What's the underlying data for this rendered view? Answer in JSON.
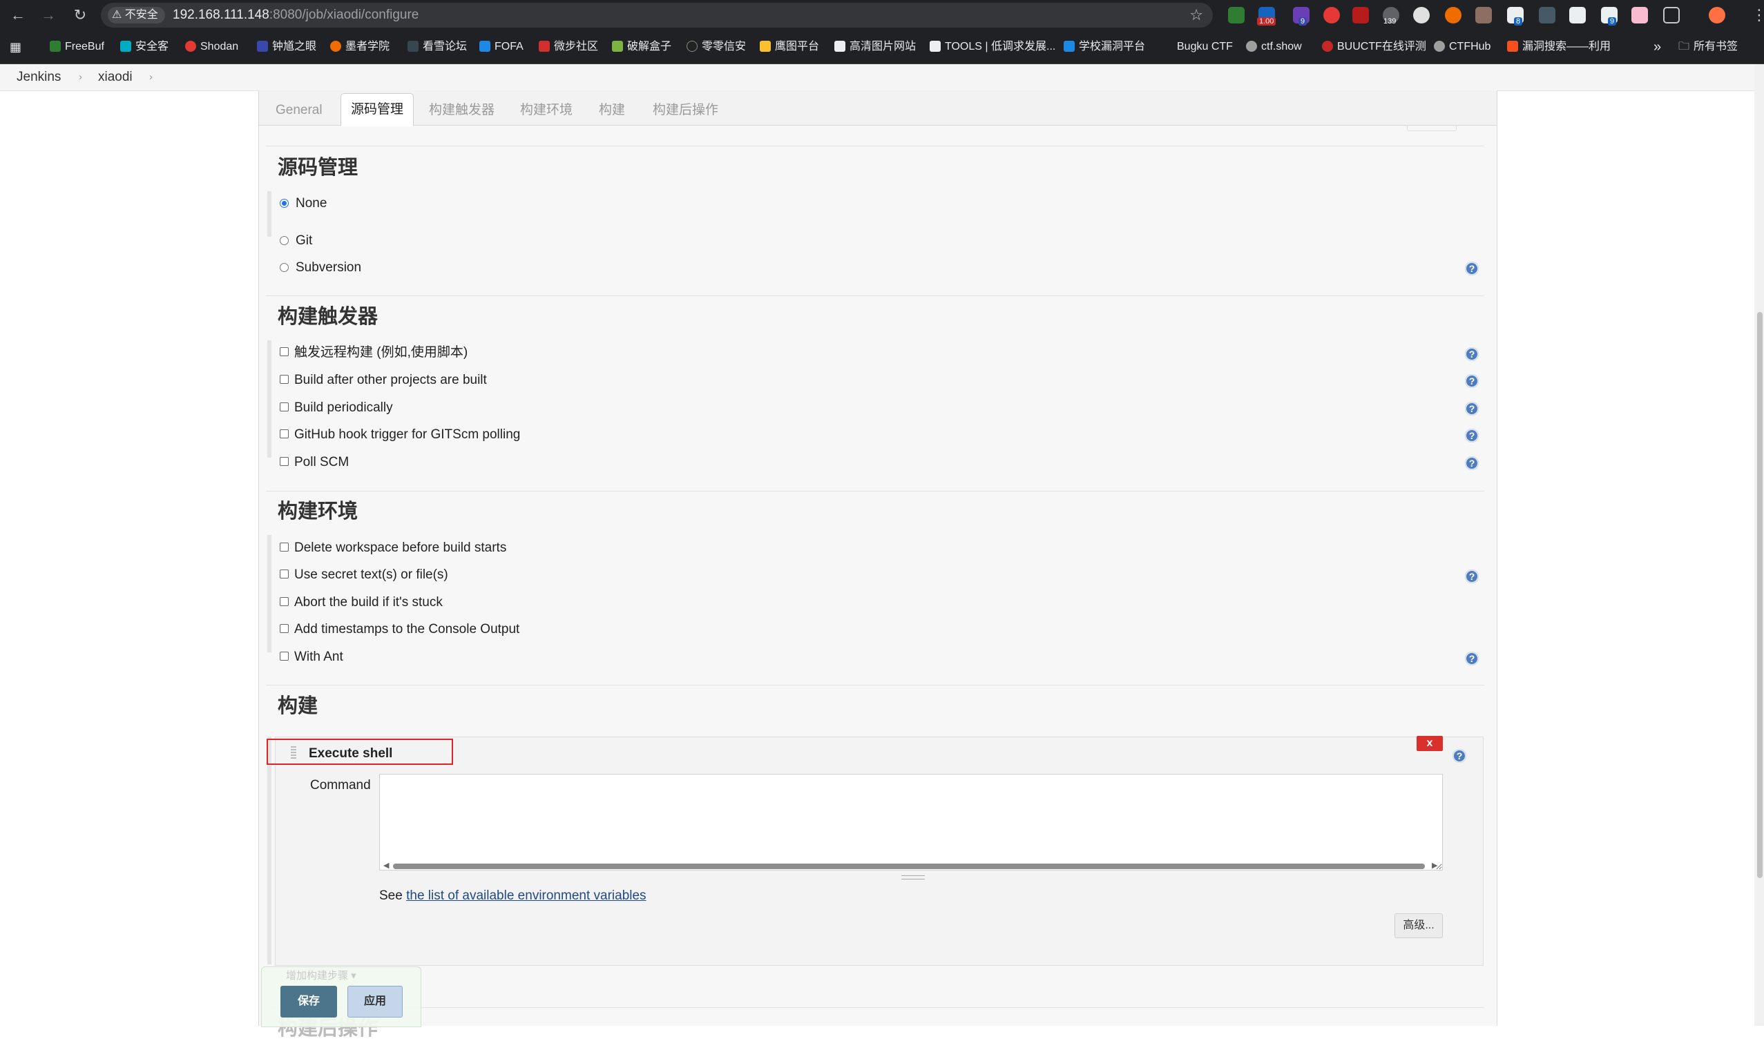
{
  "browser": {
    "security_label": "不安全",
    "url_host": "192.168.111.148",
    "url_rest": ":8080/job/xiaodi/configure",
    "extension_badges": [
      "1.00",
      "9",
      "139",
      "8",
      "9"
    ],
    "bookmarks": [
      "FreeBuf",
      "安全客",
      "Shodan",
      "钟馗之眼",
      "墨者学院",
      "看雪论坛",
      "FOFA",
      "微步社区",
      "破解盒子",
      "零零信安",
      "鹰图平台",
      "高清图片网站",
      "TOOLS | 低调求发展...",
      "学校漏洞平台",
      "Bugku CTF",
      "ctf.show",
      "BUUCTF在线评测",
      "CTFHub",
      "漏洞搜索——利用"
    ],
    "more_bookmarks": "»",
    "all_bookmarks": "所有书签"
  },
  "breadcrumb": {
    "items": [
      "Jenkins",
      "xiaodi"
    ],
    "separator": "›"
  },
  "tabs": [
    "General",
    "源码管理",
    "构建触发器",
    "构建环境",
    "构建",
    "构建后操作"
  ],
  "active_tab": "源码管理",
  "scm": {
    "title": "源码管理",
    "options": [
      "None",
      "Git",
      "Subversion"
    ],
    "selected": "None"
  },
  "triggers": {
    "title": "构建触发器",
    "options": [
      "触发远程构建 (例如,使用脚本)",
      "Build after other projects are built",
      "Build periodically",
      "GitHub hook trigger for GITScm polling",
      "Poll SCM"
    ]
  },
  "environment": {
    "title": "构建环境",
    "options": [
      "Delete workspace before build starts",
      "Use secret text(s) or file(s)",
      "Abort the build if it's stuck",
      "Add timestamps to the Console Output",
      "With Ant"
    ]
  },
  "build": {
    "title": "构建",
    "step_title": "Execute shell",
    "delete_label": "x",
    "command_label": "Command",
    "command_value": "",
    "env_prefix": "See ",
    "env_link": "the list of available environment variables",
    "advanced_label": "高级...",
    "add_step_label": "增加构建步骤 ▾"
  },
  "post_build_title": "构建后操作",
  "footer": {
    "save_label": "保存",
    "apply_label": "应用"
  },
  "colors": {
    "highlight": "#e02424",
    "help_icon": "#4e7cbf",
    "save": "#4b758b",
    "delete": "#d9302c"
  }
}
